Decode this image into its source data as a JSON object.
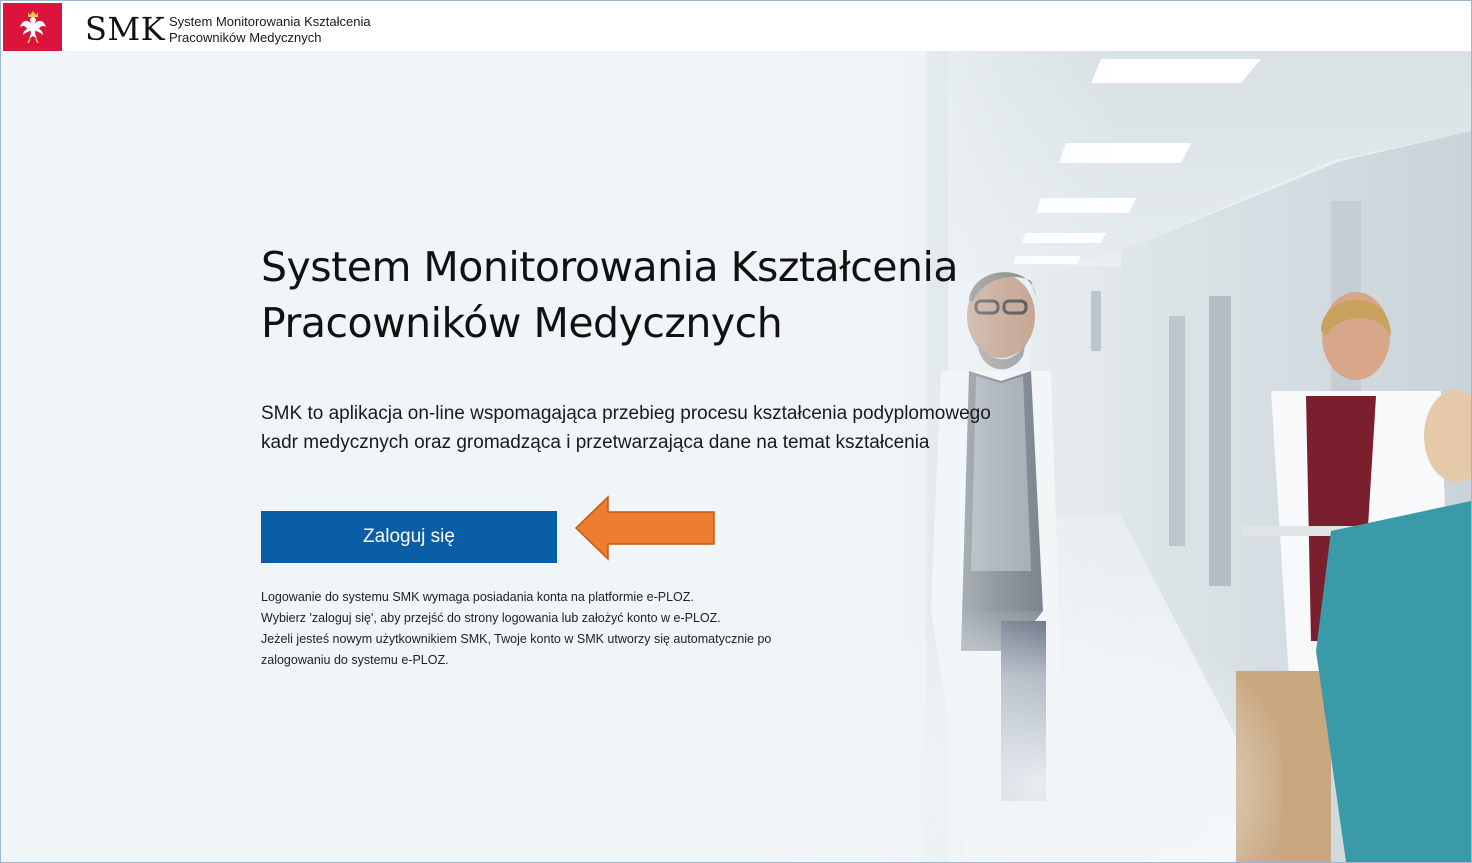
{
  "header": {
    "abbr": "SMK",
    "name_line1": "System Monitorowania Kształcenia",
    "name_line2": "Pracowników Medycznych",
    "emblem_icon": "polish-eagle-emblem-icon",
    "emblem_color": "#dc143c"
  },
  "hero": {
    "title_line1": "System Monitorowania Kształcenia",
    "title_line2": "Pracowników Medycznych",
    "desc_line1": "SMK to aplikacja on-line wspomagająca przebieg procesu kształcenia podyplomowego",
    "desc_line2": "kadr medycznych oraz gromadząca i przetwarzająca dane na temat kształcenia",
    "login_label": "Zaloguj się",
    "login_color": "#0a5ea6",
    "arrow_icon": "left-arrow-icon",
    "arrow_color": "#ed7d31"
  },
  "info": {
    "line1": "Logowanie do systemu SMK wymaga posiadania konta na platformie e-PLOZ.",
    "line2": "Wybierz 'zaloguj się', aby przejść do strony logowania lub założyć konto w e-PLOZ.",
    "line3": "Jeżeli jesteś nowym użytkownikiem SMK, Twoje konto w SMK utworzy się automatycznie po",
    "line4": "zalogowaniu do systemu e-PLOZ."
  }
}
